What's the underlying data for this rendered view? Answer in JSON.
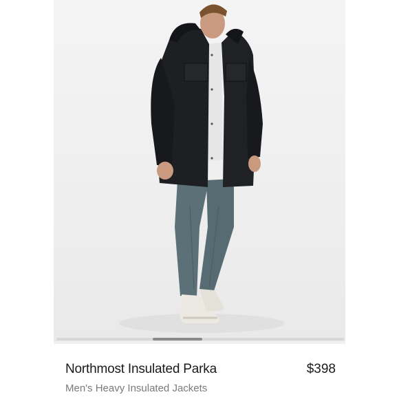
{
  "product": {
    "name": "Northmost Insulated Parka",
    "price": "$398",
    "category": "Men's Heavy Insulated Jackets",
    "image": "model-wearing-black-parka-photo"
  },
  "carousel": {
    "current_position": 0.34
  },
  "colors": {
    "jacket": "#1d1f22",
    "pants": "#5b7077",
    "background": "#f1f1f1",
    "text_primary": "#1a1a1a",
    "text_secondary": "#7a7a7a"
  }
}
